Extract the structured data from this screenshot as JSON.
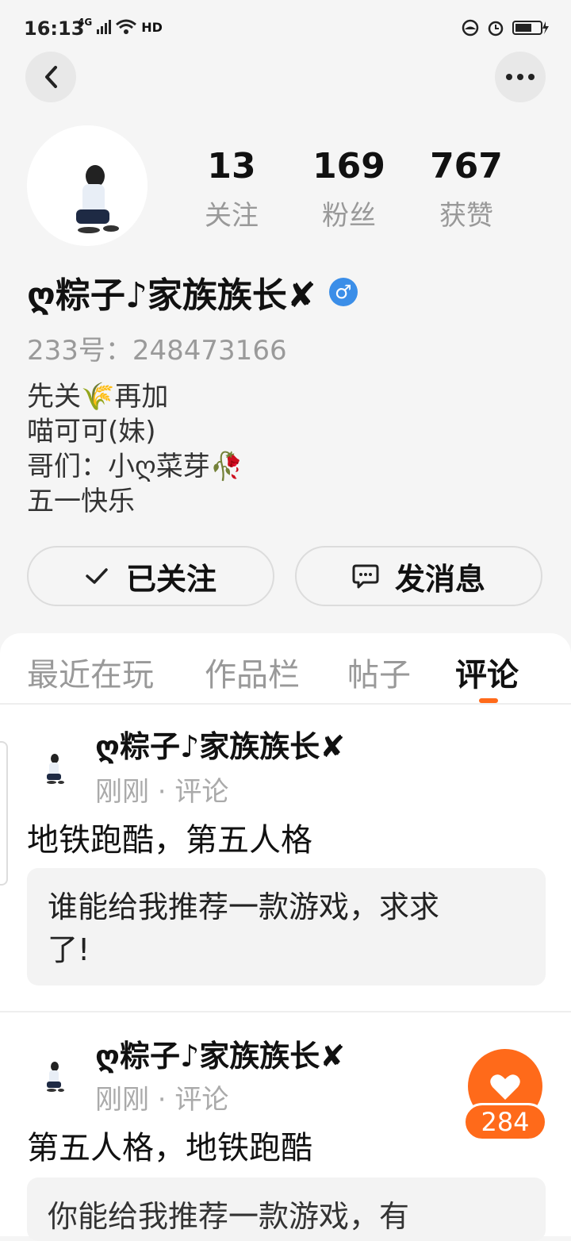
{
  "status": {
    "time": "16:13",
    "net": "4G",
    "hd": "HD"
  },
  "profile": {
    "stats": [
      {
        "num": "13",
        "label": "关注"
      },
      {
        "num": "169",
        "label": "粉丝"
      },
      {
        "num": "767",
        "label": "获赞"
      }
    ],
    "username": "ღ粽子♪家族族长✘",
    "gender_symbol": "♂",
    "uid": "233号：248473166",
    "bio": [
      "先关🌾再加",
      "喵可可(妹)",
      "哥们：小ღ菜芽🥀",
      "五一快乐"
    ]
  },
  "actions": {
    "follow_label": "已关注",
    "message_label": "发消息"
  },
  "tabs": [
    "最近在玩",
    "作品栏",
    "帖子",
    "评论"
  ],
  "posts": [
    {
      "author": "ღ粽子♪家族族长✘",
      "meta": "刚刚 · 评论",
      "title": "地铁跑酷，第五人格",
      "quote_line1": "谁能给我推荐一款游戏，求求",
      "quote_line2": "了!"
    },
    {
      "author": "ღ粽子♪家族族长✘",
      "meta": "刚刚 · 评论",
      "title": "第五人格，地铁跑酷",
      "quote_line1": "你能给我推荐一款游戏，有"
    }
  ],
  "like": {
    "count": "284"
  },
  "colors": {
    "accent": "#ff6a1a",
    "gender": "#3b8ee8"
  }
}
